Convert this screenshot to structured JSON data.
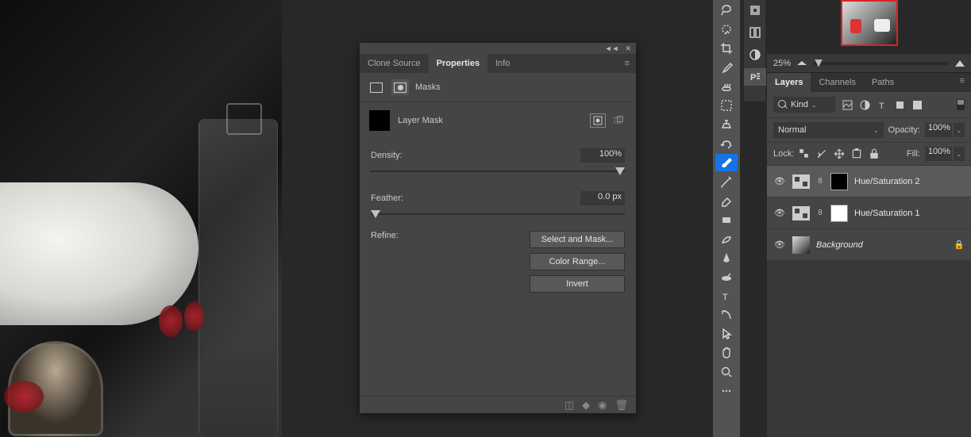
{
  "panel": {
    "tabs": {
      "clone": "Clone Source",
      "properties": "Properties",
      "info": "Info"
    },
    "masks_label": "Masks",
    "layer_mask_label": "Layer Mask",
    "density_label": "Density:",
    "density_value": "100%",
    "feather_label": "Feather:",
    "feather_value": "0.0 px",
    "refine_label": "Refine:",
    "buttons": {
      "select_mask": "Select and Mask...",
      "color_range": "Color Range...",
      "invert": "Invert"
    }
  },
  "navigator": {
    "zoom": "25%"
  },
  "layers_panel": {
    "tabs": {
      "layers": "Layers",
      "channels": "Channels",
      "paths": "Paths"
    },
    "kind_label": "Kind",
    "blend_mode": "Normal",
    "opacity_label": "Opacity:",
    "opacity_value": "100%",
    "lock_label": "Lock:",
    "fill_label": "Fill:",
    "fill_value": "100%",
    "layers": [
      {
        "name": "Hue/Saturation 2",
        "mask": "black",
        "selected": true
      },
      {
        "name": "Hue/Saturation 1",
        "mask": "white",
        "selected": false
      },
      {
        "name": "Background",
        "bg": true
      }
    ]
  }
}
